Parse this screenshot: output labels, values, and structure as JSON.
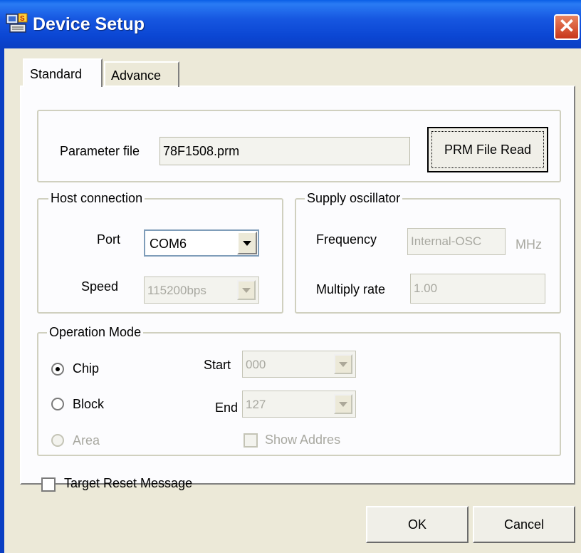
{
  "window": {
    "title": "Device Setup",
    "close_glyph": "✕"
  },
  "tabs": [
    {
      "label": "Standard",
      "selected": true
    },
    {
      "label": "Advance",
      "selected": false
    }
  ],
  "parameter_file": {
    "label": "Parameter file",
    "value": "78F1508.prm",
    "read_button": "PRM File Read"
  },
  "host_connection": {
    "legend": "Host connection",
    "port_label": "Port",
    "port_value": "COM6",
    "speed_label": "Speed",
    "speed_value": "115200bps"
  },
  "supply_oscillator": {
    "legend": "Supply oscillator",
    "frequency_label": "Frequency",
    "frequency_value": "Internal-OSC",
    "frequency_unit": "MHz",
    "multiply_label": "Multiply rate",
    "multiply_value": "1.00"
  },
  "operation_mode": {
    "legend": "Operation Mode",
    "chip_label": "Chip",
    "block_label": "Block",
    "area_label": "Area",
    "selected": "Chip",
    "start_label": "Start",
    "start_value": "000",
    "end_label": "End",
    "end_value": "127",
    "show_address_label": "Show Addres"
  },
  "target_reset_label": "Target Reset Message",
  "buttons": {
    "ok": "OK",
    "cancel": "Cancel"
  },
  "colors": {
    "titlebar": "#0b46d3",
    "dialog_bg": "#ece9d8",
    "close_button": "#c8361a"
  }
}
